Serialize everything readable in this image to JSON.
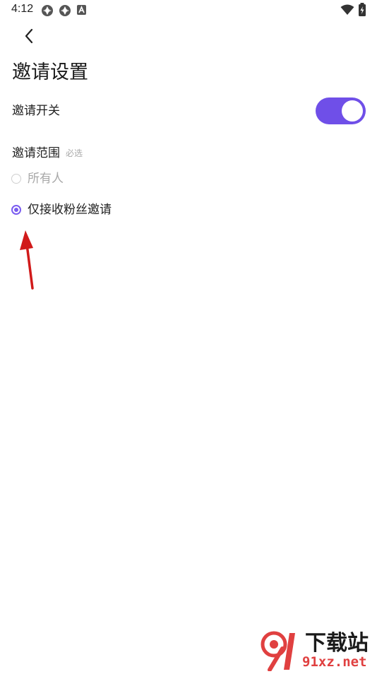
{
  "status_bar": {
    "time": "4:12"
  },
  "header": {
    "title": "邀请设置"
  },
  "invite_switch": {
    "label": "邀请开关",
    "enabled": true
  },
  "invite_scope": {
    "label": "邀请范围",
    "required_tag": "必选",
    "options": [
      {
        "label": "所有人",
        "selected": false,
        "disabled": true
      },
      {
        "label": "仅接收粉丝邀请",
        "selected": true,
        "disabled": false
      }
    ]
  },
  "watermark": {
    "logo_text": "91",
    "brand": "下载站",
    "domain": "91xz.net"
  },
  "colors": {
    "accent": "#7a5cf0",
    "toggle_track": "#6f4fe8",
    "disabled_text": "#a8a8a8",
    "arrow": "#d11a1a",
    "watermark_red": "#e04040"
  }
}
